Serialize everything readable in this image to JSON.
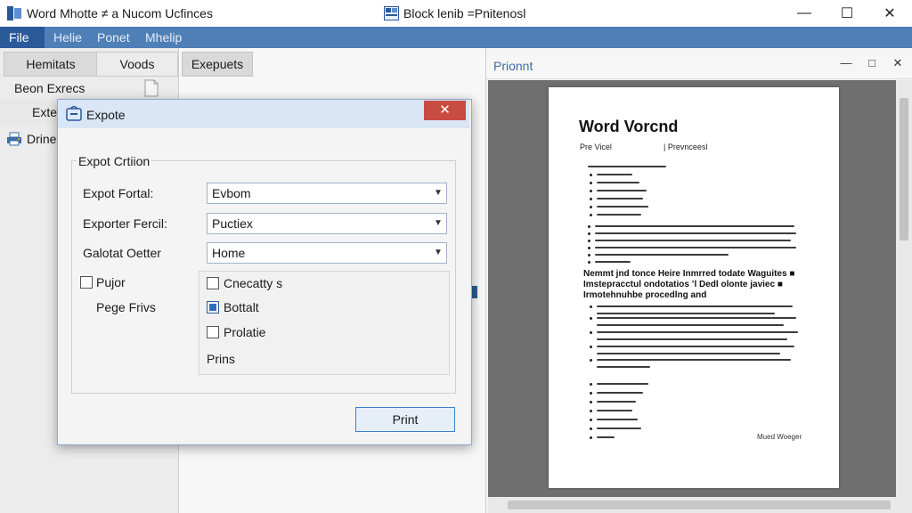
{
  "window": {
    "app_title": "Word Mhotte ≠ a Nucom Ucfinces",
    "doc_title": "Block lenib =Pnitenosl",
    "minimize_glyph": "—",
    "maximize_glyph": "☐",
    "close_glyph": "✕"
  },
  "menu": {
    "items": [
      "File",
      "Helie",
      "Ponet",
      "Mhelip"
    ]
  },
  "left_panel": {
    "tabs": [
      "Hemitats",
      "Voods"
    ],
    "rows": [
      "Beon Exrecs",
      "Exte",
      "Drine"
    ]
  },
  "middle_panel": {
    "tab": "Exepuets"
  },
  "preview": {
    "title": "Prionnt",
    "min_glyph": "—",
    "max_glyph": "□",
    "close_glyph": "✕",
    "page": {
      "title": "Word Vorcnd",
      "sub_left": "Pre Vicel",
      "sub_right": "| Prevnceesl",
      "heading": "Nemmt jnd tonce Heire Inmrred todate Waguites ■ Imstepracctul ondotatios ’l Dedl olonte javiec ■ Irmotehnuhbe procedlng and",
      "signature": "Mued Woeger"
    }
  },
  "dialog": {
    "title": "Expote",
    "close_glyph": "✕",
    "group_title": "Expot Crtiion",
    "fields": [
      {
        "label": "Expot Fortal:",
        "value": "Evbom"
      },
      {
        "label": "Exporter Fercil:",
        "value": "Puctiex"
      },
      {
        "label": "Galotat Oetter",
        "value": "Home"
      }
    ],
    "left_check_label": "Pujor",
    "left_sub_label": "Pege Frivs",
    "options": [
      {
        "label": "Cnecatty s",
        "checked": false
      },
      {
        "label": "Bottalt",
        "checked": true
      },
      {
        "label": "Prolatie",
        "checked": false
      }
    ],
    "options_footer": "Prins",
    "print_label": "Print"
  },
  "colors": {
    "menubar": "#4e7fb6",
    "menu_file_active": "#2a5a98",
    "dialog_close": "#c94c43",
    "preview_bg": "#6f6f6f"
  }
}
